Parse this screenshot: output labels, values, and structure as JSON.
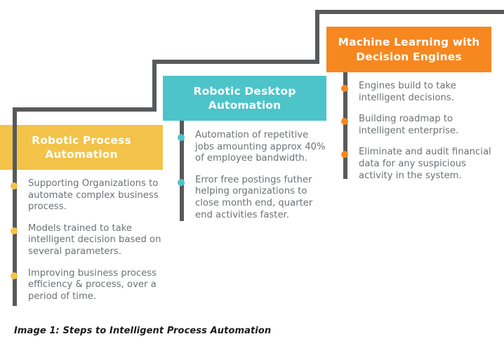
{
  "figure": {
    "caption": "Image 1: Steps to Intelligent Process Automation"
  },
  "colors": {
    "stage_1": "#F2C348",
    "stage_2": "#4CC4CA",
    "stage_3": "#F7871F",
    "connector_line": "#58595B",
    "body_text": "#6E7174",
    "header_text": "#FFFFFF",
    "background": "#FFFFFF"
  },
  "stages": [
    {
      "id": "robotic-process-automation",
      "title": "Robotic Process Automation",
      "accent": "#F2C348",
      "step": 1,
      "bullets": [
        "Supporting Organizations to automate complex business process.",
        "Models trained to take intelligent decision based on several parameters.",
        "Improving business process efficiency & process, over a period of time."
      ]
    },
    {
      "id": "robotic-desktop-automation",
      "title": "Robotic Desktop Automation",
      "accent": "#4CC4CA",
      "step": 2,
      "bullets": [
        "Automation of repetitive jobs amounting approx 40% of employee bandwidth.",
        "Error free postings futher helping organizations to close month end, quarter end activities faster."
      ]
    },
    {
      "id": "machine-learning-with-decision-engines",
      "title": "Machine Learning with Decision Engines",
      "accent": "#F7871F",
      "step": 3,
      "bullets": [
        "Engines build to take intelligent decisions.",
        "Building roadmap to intelligent enterprise.",
        "Eliminate and audit financial data for any suspicious activity in the system."
      ]
    }
  ]
}
